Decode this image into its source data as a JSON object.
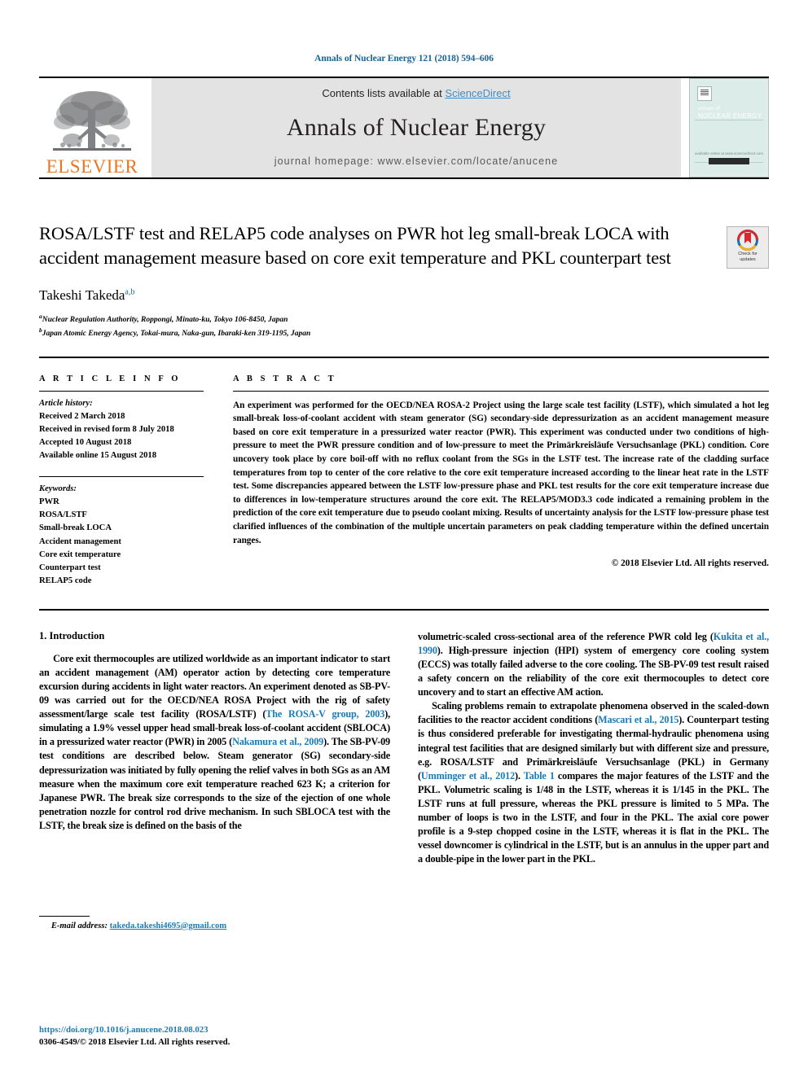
{
  "running_head": "Annals of Nuclear Energy 121 (2018) 594–606",
  "masthead": {
    "publisher_name": "ELSEVIER",
    "contents_prefix": "Contents lists available at ",
    "contents_link": "ScienceDirect",
    "journal_title": "Annals of Nuclear Energy",
    "homepage": "journal homepage: www.elsevier.com/locate/anucene",
    "cover": {
      "line1": "annals of",
      "line2": "NUCLEAR ENERGY",
      "footer_text": "available online at www.sciencedirect.com",
      "footer_badge": "ScienceDirect"
    }
  },
  "article": {
    "title": "ROSA/LSTF test and RELAP5 code analyses on PWR hot leg small-break LOCA with accident management measure based on core exit temperature and PKL counterpart test",
    "author": "Takeshi Takeda",
    "author_marks": "a,b",
    "affiliations": [
      {
        "mark": "a",
        "text": "Nuclear Regulation Authority, Roppongi, Minato-ku, Tokyo 106-8450, Japan"
      },
      {
        "mark": "b",
        "text": "Japan Atomic Energy Agency, Tokai-mura, Naka-gun, Ibaraki-ken 319-1195, Japan"
      }
    ],
    "crossmark": {
      "line1": "Check for",
      "line2": "updates"
    }
  },
  "article_info": {
    "heading": "A R T I C L E   I N F O",
    "history_label": "Article history:",
    "history": [
      "Received 2 March 2018",
      "Received in revised form 8 July 2018",
      "Accepted 10 August 2018",
      "Available online 15 August 2018"
    ],
    "keywords_label": "Keywords:",
    "keywords": [
      "PWR",
      "ROSA/LSTF",
      "Small-break LOCA",
      "Accident management",
      "Core exit temperature",
      "Counterpart test",
      "RELAP5 code"
    ]
  },
  "abstract": {
    "heading": "A B S T R A C T",
    "text": "An experiment was performed for the OECD/NEA ROSA-2 Project using the large scale test facility (LSTF), which simulated a hot leg small-break loss-of-coolant accident with steam generator (SG) secondary-side depressurization as an accident management measure based on core exit temperature in a pressurized water reactor (PWR). This experiment was conducted under two conditions of high-pressure to meet the PWR pressure condition and of low-pressure to meet the Primärkreisläufe Versuchsanlage (PKL) condition. Core uncovery took place by core boil-off with no reflux coolant from the SGs in the LSTF test. The increase rate of the cladding surface temperatures from top to center of the core relative to the core exit temperature increased according to the linear heat rate in the LSTF test. Some discrepancies appeared between the LSTF low-pressure phase and PKL test results for the core exit temperature increase due to differences in low-temperature structures around the core exit. The RELAP5/MOD3.3 code indicated a remaining problem in the prediction of the core exit temperature due to pseudo coolant mixing. Results of uncertainty analysis for the LSTF low-pressure phase test clarified influences of the combination of the multiple uncertain parameters on peak cladding temperature within the defined uncertain ranges.",
    "copyright": "© 2018 Elsevier Ltd. All rights reserved."
  },
  "introduction": {
    "heading": "1. Introduction",
    "left_paragraph": {
      "p1_a": "Core exit thermocouples are utilized worldwide as an important indicator to start an accident management (AM) operator action by detecting core temperature excursion during accidents in light water reactors. An experiment denoted as SB-PV-09 was carried out for the OECD/NEA ROSA Project with the rig of safety assessment/large scale test facility (ROSA/LSTF) (",
      "ref1": "The ROSA-V group, 2003",
      "p1_b": "), simulating a 1.9% vessel upper head small-break loss-of-coolant accident (SBLOCA) in a pressurized water reactor (PWR) in 2005 (",
      "ref2": "Nakamura et al., 2009",
      "p1_c": "). The SB-PV-09 test conditions are described below. Steam generator (SG) secondary-side depressurization was initiated by fully opening the relief valves in both SGs as an AM measure when the maximum core exit temperature reached 623 K; a criterion for Japanese PWR. The break size corresponds to the size of the ejection of one whole penetration nozzle for control rod drive mechanism. In such SBLOCA test with the LSTF, the break size is defined on the basis of the"
    },
    "right_paragraph": {
      "p2_a": "volumetric-scaled cross-sectional area of the reference PWR cold leg (",
      "ref3": "Kukita et al., 1990",
      "p2_b": "). High-pressure injection (HPI) system of emergency core cooling system (ECCS) was totally failed adverse to the core cooling. The SB-PV-09 test result raised a safety concern on the reliability of the core exit thermocouples to detect core uncovery and to start an effective AM action.",
      "p3_a": "Scaling problems remain to extrapolate phenomena observed in the scaled-down facilities to the reactor accident conditions (",
      "ref4": "Mascari et al., 2015",
      "p3_b": "). Counterpart testing is thus considered preferable for investigating thermal-hydraulic phenomena using integral test facilities that are designed similarly but with different size and pressure, e.g. ROSA/LSTF and Primärkreisläufe Versuchsanlage (PKL) in Germany (",
      "ref5": "Umminger et al., 2012",
      "p3_b2": "). ",
      "ref6": "Table 1",
      "p3_c": " compares the major features of the LSTF and the PKL. Volumetric scaling is 1/48 in the LSTF, whereas it is 1/145 in the PKL. The LSTF runs at full pressure, whereas the PKL pressure is limited to 5 MPa. The number of loops is two in the LSTF, and four in the PKL. The axial core power profile is a 9-step chopped cosine in the LSTF, whereas it is flat in the PKL. The vessel downcomer is cylindrical in the LSTF, but is an annulus in the upper part and a double-pipe in the lower part in the PKL."
    }
  },
  "footnote": {
    "label": "E-mail address:",
    "email": "takeda.takeshi4695@gmail.com"
  },
  "page_footer": {
    "doi": "https://doi.org/10.1016/j.anucene.2018.08.023",
    "issn_line": "0306-4549/© 2018 Elsevier Ltd. All rights reserved."
  },
  "colors": {
    "link": "#1a7bb9",
    "running_head": "#1a6496",
    "elsevier_orange": "#e87722",
    "sciencedirect": "#3b8ecb",
    "masthead_bg": "#e3e3e3",
    "cover_bg": "#dcece8"
  }
}
